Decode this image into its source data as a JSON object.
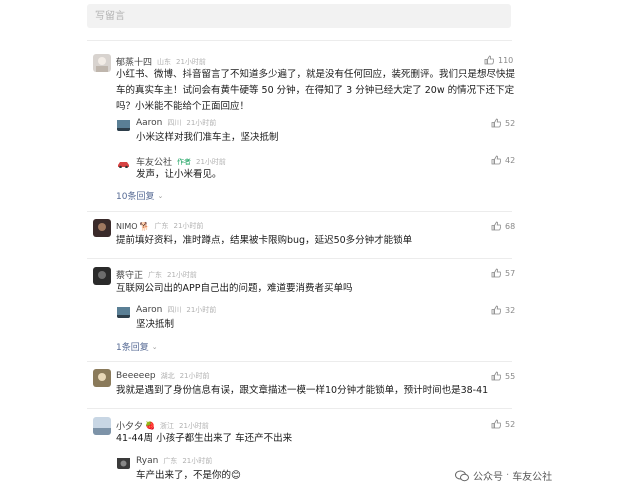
{
  "input": {
    "placeholder": "写留言"
  },
  "comments": [
    {
      "name": "郁蒸十四",
      "location": "山东",
      "time": "21小时前",
      "likes": "110",
      "lines": [
        "小红书、微博、抖音留言了不知道多少遍了，就是没有任何回应，装死删评。我们只是想尽快提",
        "车的真实车主！试问会有黄牛硬等 50 分钟，在得知了 3 分钟已经大定了 20w 的情况下还下定",
        "吗？小米能不能给个正面回应！"
      ],
      "replies": [
        {
          "name": "Aaron",
          "location": "四川",
          "time": "21小时前",
          "likes": "52",
          "text": "小米这样对我们准车主，坚决抵制"
        },
        {
          "name": "车友公社",
          "badge": "作者",
          "time": "21小时前",
          "likes": "42",
          "text": "发声，让小米看见。"
        }
      ],
      "more": "10条回复"
    },
    {
      "name": "NIMO",
      "location": "广东",
      "time": "21小时前",
      "likes": "68",
      "lines": [
        "提前填好资料，准时蹲点，结果被卡限购bug，延迟50多分钟才能锁单"
      ]
    },
    {
      "name": "蔡守正",
      "location": "广东",
      "time": "21小时前",
      "likes": "57",
      "lines": [
        "互联网公司出的APP自己出的问题，难道要消费者买单吗"
      ],
      "replies": [
        {
          "name": "Aaron",
          "location": "四川",
          "time": "21小时前",
          "likes": "32",
          "text": "坚决抵制"
        }
      ],
      "more": "1条回复"
    },
    {
      "name": "Beeeeep",
      "location": "湖北",
      "time": "21小时前",
      "likes": "55",
      "lines": [
        "我就是遇到了身份信息有误，跟文章描述一模一样10分钟才能锁单，预计时间也是38-41"
      ]
    },
    {
      "name": "小夕夕",
      "location": "浙江",
      "time": "21小时前",
      "likes": "52",
      "lines": [
        "41-44周 小孩子都生出来了 车还产不出来"
      ],
      "replies": [
        {
          "name": "Ryan",
          "location": "广东",
          "time": "21小时前",
          "text": "车产出来了，不是你的😊"
        }
      ]
    }
  ],
  "watermark": {
    "left": "公众号",
    "right": "车友公社"
  },
  "colors": {
    "link": "#576b95",
    "author": "#17a05d",
    "meta": "#b0b0b0",
    "input_bg": "#f2f2f2"
  }
}
